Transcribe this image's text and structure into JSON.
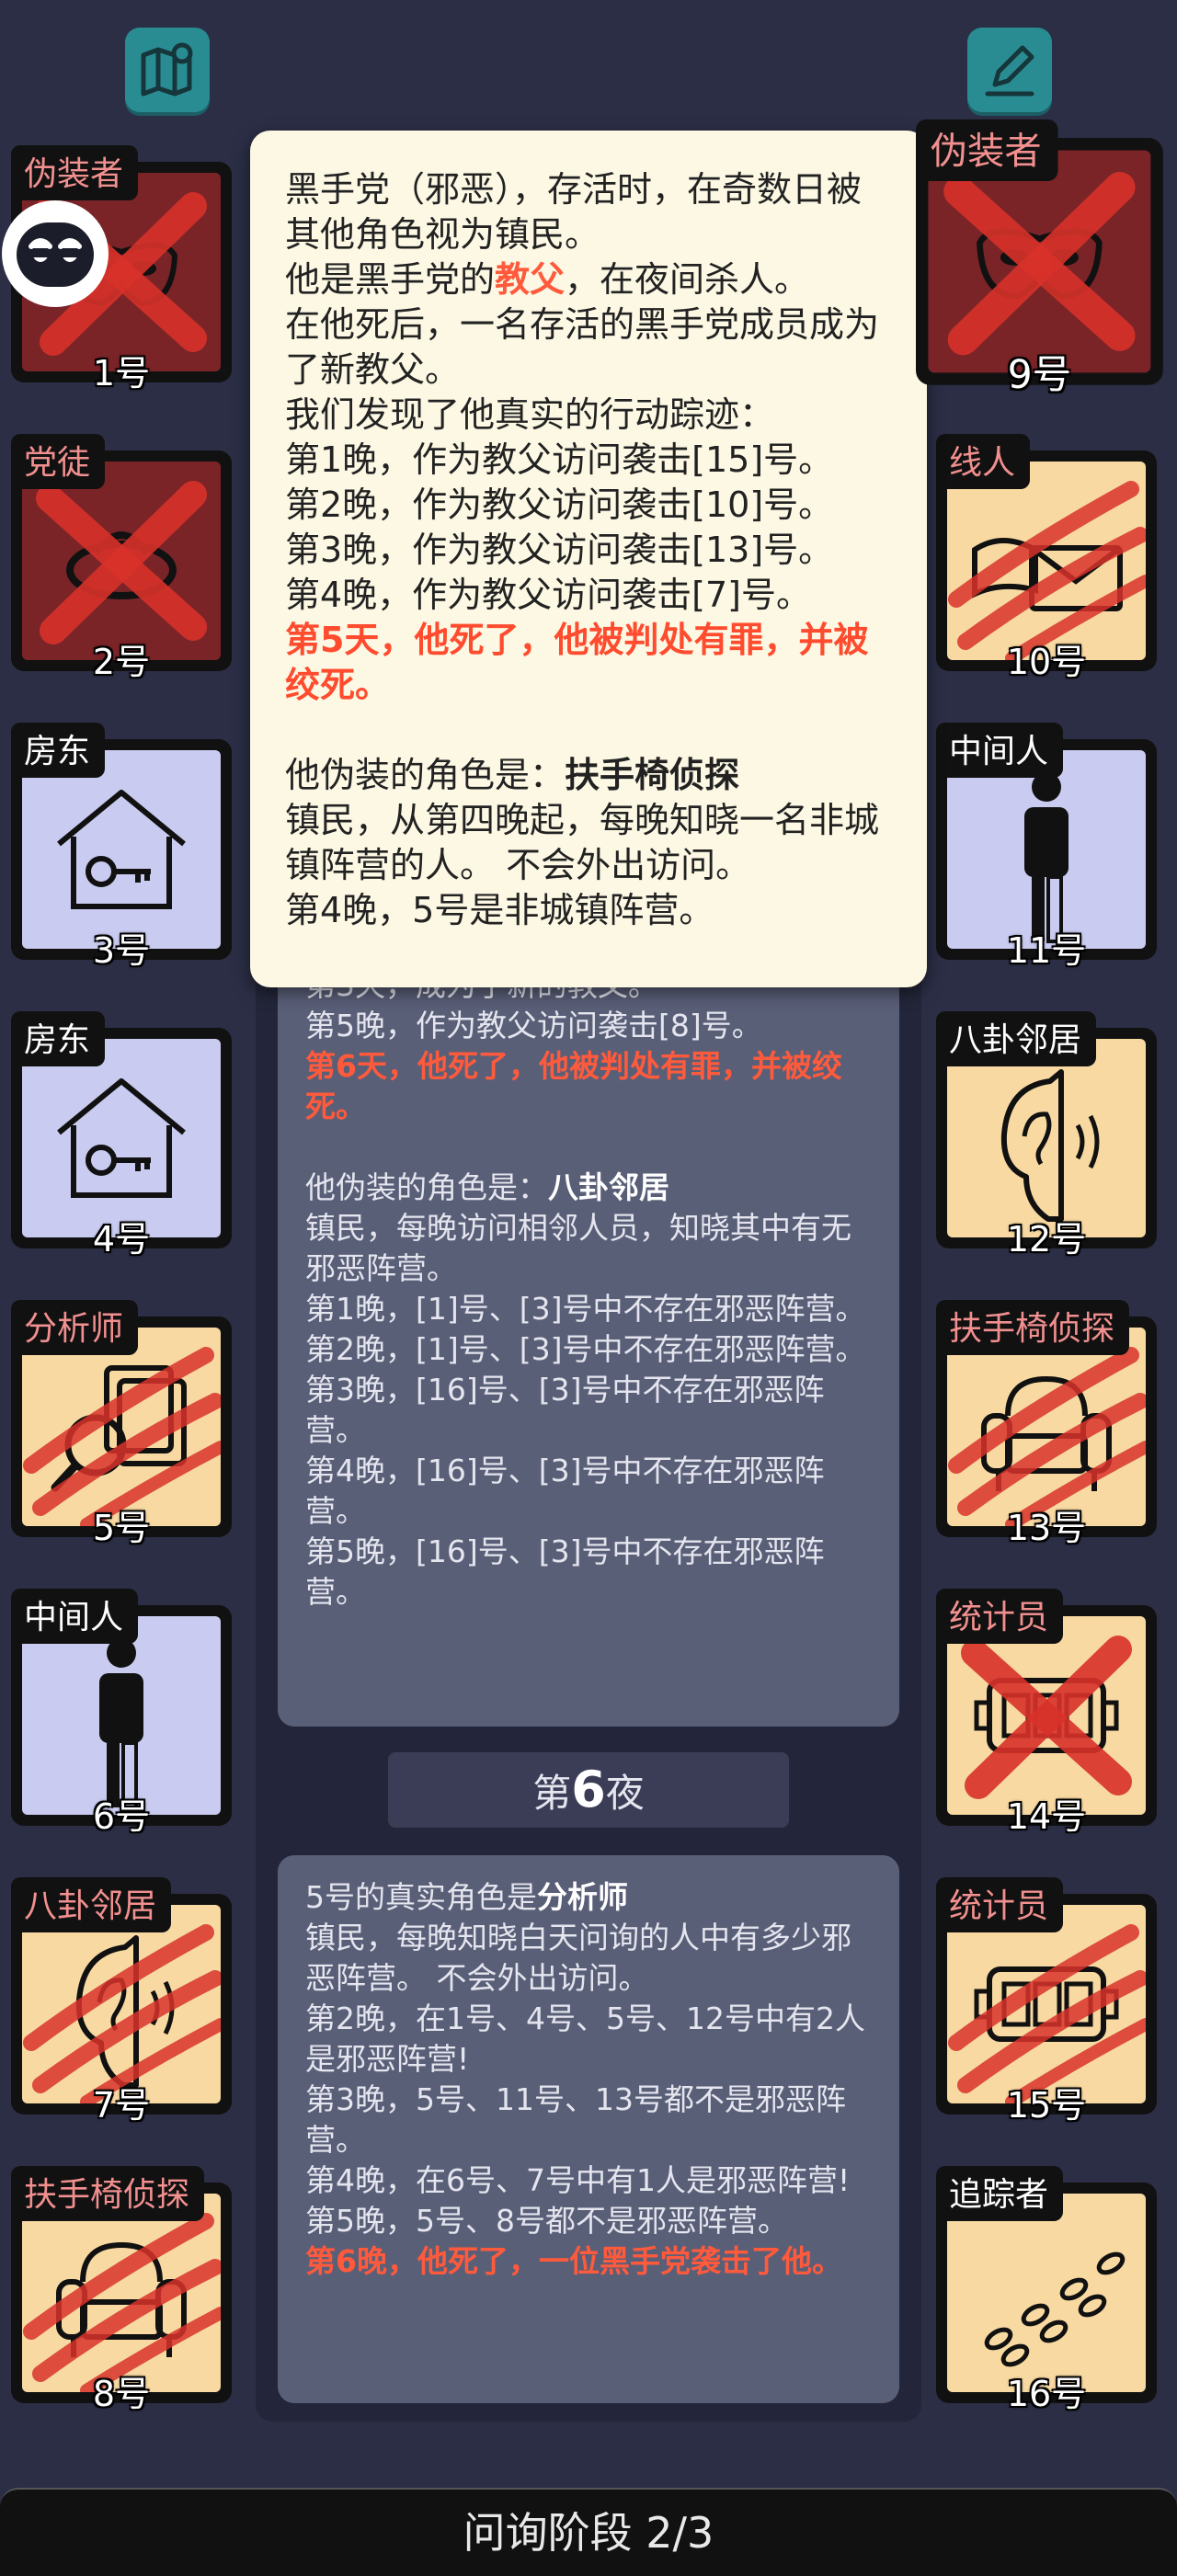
{
  "top_icons": {
    "left": "map-icon",
    "right": "edit-icon"
  },
  "accent_colors": {
    "evil_red": "#ff5a3c",
    "town_blue": "#c9cbf0",
    "neutral_orange": "#f8d9a2",
    "dead_dark": "#7a2428"
  },
  "players": [
    {
      "number": "1号",
      "role": "伪装者",
      "state": "dead-crossed",
      "bg": "dark",
      "icon": "mask-icon"
    },
    {
      "number": "2号",
      "role": "党徒",
      "state": "dead-crossed",
      "bg": "dark",
      "icon": "ring-icon"
    },
    {
      "number": "3号",
      "role": "房东",
      "state": "alive",
      "bg": "blue",
      "icon": "house-key-icon"
    },
    {
      "number": "4号",
      "role": "房东",
      "state": "alive",
      "bg": "blue",
      "icon": "house-key-icon"
    },
    {
      "number": "5号",
      "role": "分析师",
      "state": "dead-clawed",
      "bg": "orange",
      "icon": "magnifier-icon"
    },
    {
      "number": "6号",
      "role": "中间人",
      "state": "alive",
      "bg": "blue",
      "icon": "person-icon"
    },
    {
      "number": "7号",
      "role": "八卦邻居",
      "state": "dead-clawed",
      "bg": "orange",
      "icon": "ear-icon"
    },
    {
      "number": "8号",
      "role": "扶手椅侦探",
      "state": "dead-clawed",
      "bg": "orange",
      "icon": "armchair-icon"
    },
    {
      "number": "9号",
      "role": "伪装者",
      "state": "dead-crossed",
      "bg": "dark",
      "icon": "mask-icon"
    },
    {
      "number": "10号",
      "role": "线人",
      "state": "dead-clawed",
      "bg": "orange",
      "icon": "envelope-icon"
    },
    {
      "number": "11号",
      "role": "中间人",
      "state": "alive",
      "bg": "blue",
      "icon": "person-icon"
    },
    {
      "number": "12号",
      "role": "八卦邻居",
      "state": "alive",
      "bg": "orange",
      "icon": "ear-icon"
    },
    {
      "number": "13号",
      "role": "扶手椅侦探",
      "state": "dead-clawed",
      "bg": "orange",
      "icon": "armchair-icon"
    },
    {
      "number": "14号",
      "role": "统计员",
      "state": "dead-crossed",
      "bg": "orange",
      "icon": "counter-icon"
    },
    {
      "number": "15号",
      "role": "统计员",
      "state": "dead-clawed",
      "bg": "orange",
      "icon": "counter-icon"
    },
    {
      "number": "16号",
      "role": "追踪者",
      "state": "alive",
      "bg": "orange",
      "icon": "footprints-icon"
    }
  ],
  "tooltip": {
    "line1": "黑手党（邪恶），存活时，在奇数日被其他角色视为镇民。",
    "line2_pre": "他是黑手党的",
    "line2_role": "教父",
    "line2_post": "，在夜间杀人。",
    "line3": "在他死后，一名存活的黑手党成员成为了新教父。",
    "line4": "我们发现了他真实的行动踪迹：",
    "actions": [
      "第1晚，作为教父访问袭击[15]号。",
      "第2晚，作为教父访问袭击[10]号。",
      "第3晚，作为教父访问袭击[13]号。",
      "第4晚，作为教父访问袭击[7]号。"
    ],
    "death": "第5天，他死了，他被判处有罪，并被绞死。",
    "disguise_pre": "他伪装的角色是：",
    "disguise_role": "扶手椅侦探",
    "disguise_desc": "镇民，从第四晚起，每晚知晓一名非城镇阵营的人。 不会外出访问。",
    "disguise_result": "第4晚，5号是非城镇阵营。"
  },
  "log1": {
    "partial_top": "第3天，成为了新的教父。",
    "line_night5": "第5晚，作为教父访问袭击[8]号。",
    "death": "第6天，他死了，他被判处有罪，并被绞死。",
    "disguise_pre": "他伪装的角色是：",
    "disguise_role": "八卦邻居",
    "desc": "镇民，每晚访问相邻人员，知晓其中有无邪恶阵营。",
    "results": [
      "第1晚，[1]号、[3]号中不存在邪恶阵营。",
      "第2晚，[1]号、[3]号中不存在邪恶阵营。",
      "第3晚，[16]号、[3]号中不存在邪恶阵营。",
      "第4晚，[16]号、[3]号中不存在邪恶阵营。",
      "第5晚，[16]号、[3]号中不存在邪恶阵营。"
    ]
  },
  "night_banner": {
    "pre": "第",
    "number": "6",
    "post": "夜"
  },
  "log2": {
    "title_pre": "5号的真实角色是",
    "title_role": "分析师",
    "desc": "镇民，每晚知晓白天问询的人中有多少邪恶阵营。 不会外出访问。",
    "results": [
      "第2晚，在1号、4号、5号、12号中有2人是邪恶阵营!",
      "第3晚，5号、11号、13号都不是邪恶阵营。",
      "第4晚，在6号、7号中有1人是邪恶阵营!",
      "第5晚，5号、8号都不是邪恶阵营。"
    ],
    "death": "第6晚，他死了，一位黑手党袭击了他。"
  },
  "phase": "问询阶段 2/3"
}
